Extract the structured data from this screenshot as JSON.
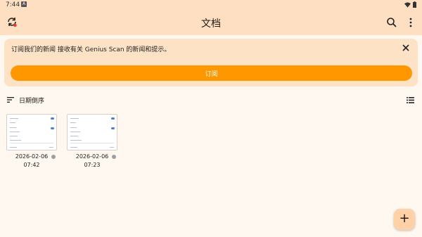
{
  "status_bar": {
    "time": "7:44",
    "notification_glyph": "A"
  },
  "app_bar": {
    "title": "文档"
  },
  "banner": {
    "message": "订阅我们的新闻 接收有关 Genius Scan 的新闻和提示。",
    "subscribe_label": "订阅"
  },
  "sort": {
    "label": "日期倒序"
  },
  "documents": [
    {
      "date": "2026-02-06",
      "time": "07:42"
    },
    {
      "date": "2026-02-06",
      "time": "07:23"
    }
  ],
  "fab": {
    "label": "+"
  },
  "colors": {
    "app_bar": "#ffdfc2",
    "background": "#fff8f1",
    "banner": "#fde2c6",
    "accent": "#ff9800"
  }
}
